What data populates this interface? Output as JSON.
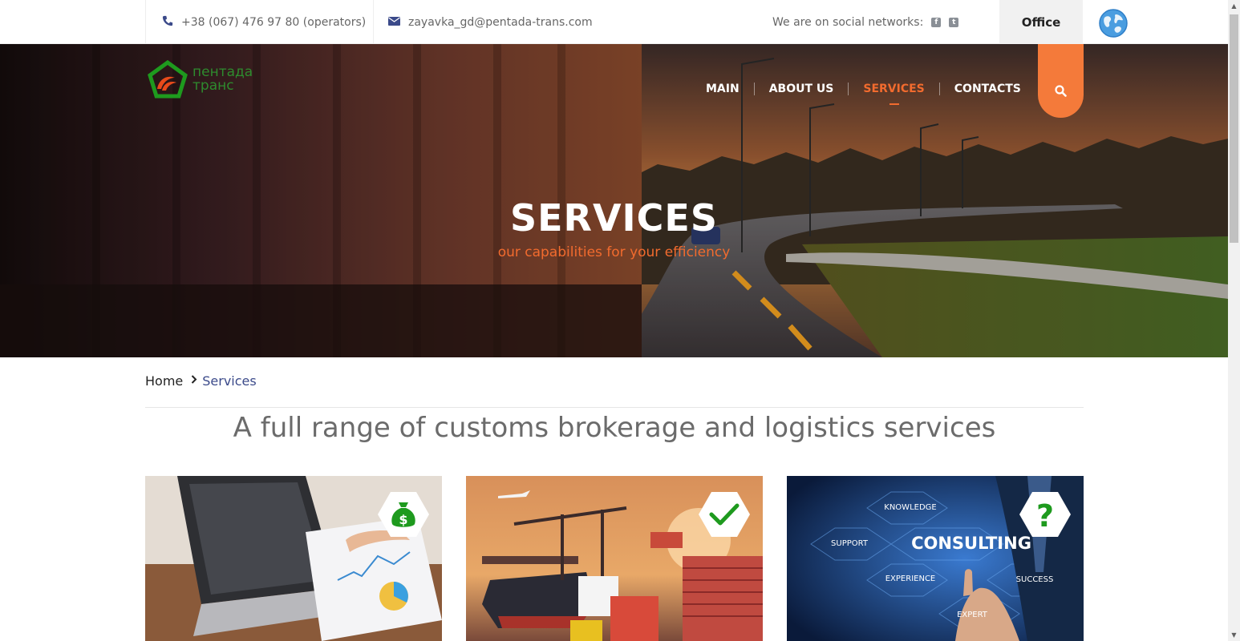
{
  "topbar": {
    "phone": "+38 (067) 476 97 80 (operators)",
    "email": "zayavka_gd@pentada-trans.com",
    "social_label": "We are on social networks:",
    "social_icons": [
      "facebook-icon",
      "tumblr-icon"
    ],
    "office_label": "Office"
  },
  "logo": {
    "line1": "пентада",
    "line2": "транс"
  },
  "nav": {
    "items": [
      {
        "label": "MAIN"
      },
      {
        "label": "ABOUT US"
      },
      {
        "label": "SERVICES",
        "active": true
      },
      {
        "label": "CONTACTS"
      }
    ]
  },
  "hero": {
    "title": "SERVICES",
    "subtitle": "our capabilities for your efficiency"
  },
  "breadcrumb": {
    "home": "Home",
    "separator": "›",
    "current": "Services"
  },
  "section": {
    "title": "A full range of customs brokerage and logistics services"
  },
  "cards": [
    {
      "icon": "money-bag-icon"
    },
    {
      "icon": "checkmark-icon"
    },
    {
      "icon": "question-icon",
      "image_words": [
        "KNOWLEDGE",
        "SUPPORT",
        "CONSULTING",
        "EXPERIENCE",
        "SUCCESS",
        "EXPERT"
      ]
    }
  ],
  "colors": {
    "accent": "#f26b2e",
    "search_bg": "#f47a3a",
    "breadcrumb_current": "#3b4a8a",
    "icon_green": "#1e9a1e"
  }
}
